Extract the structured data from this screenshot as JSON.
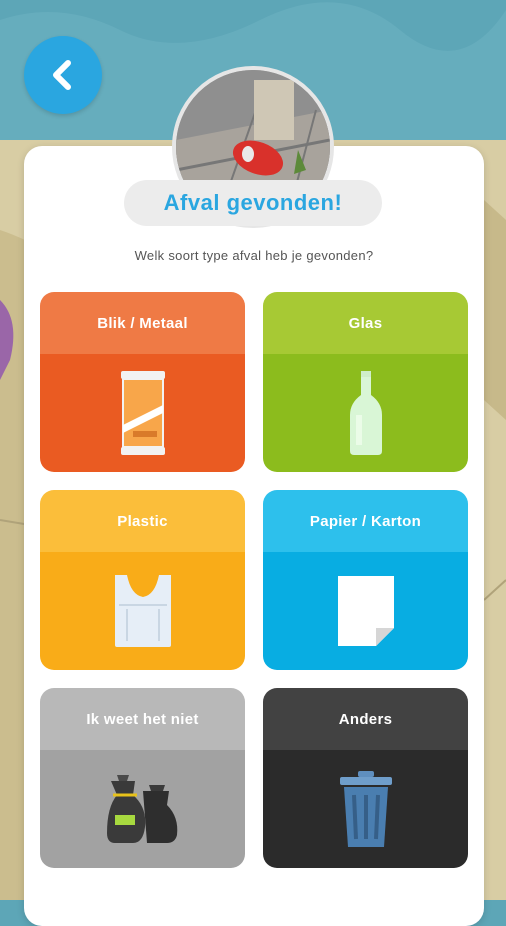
{
  "header": {
    "back_icon": "chevron-left-icon",
    "title": "Afval gevonden!",
    "question": "Welk soort type afval heb je gevonden?"
  },
  "colors": {
    "accent": "#2aa6e0",
    "blik_top": "#ef7a45",
    "blik_bottom": "#ea5b22",
    "glas_top": "#a7c934",
    "glas_bottom": "#8cbc1d",
    "plastic_top": "#fbbe3a",
    "plastic_bottom": "#f9ac18",
    "papier_top": "#2dc0ec",
    "papier_bottom": "#08ade2",
    "onbekend_top": "#b8b8b8",
    "onbekend_bottom": "#a2a2a2",
    "anders_top": "#424242",
    "anders_bottom": "#2b2b2b"
  },
  "categories": [
    {
      "label": "Blik / Metaal",
      "icon": "can-icon"
    },
    {
      "label": "Glas",
      "icon": "glass-bottle-icon"
    },
    {
      "label": "Plastic",
      "icon": "plastic-bag-icon"
    },
    {
      "label": "Papier / Karton",
      "icon": "paper-sheet-icon"
    },
    {
      "label": "Ik weet het niet",
      "icon": "garbage-bags-icon"
    },
    {
      "label": "Anders",
      "icon": "trash-bin-icon"
    }
  ]
}
